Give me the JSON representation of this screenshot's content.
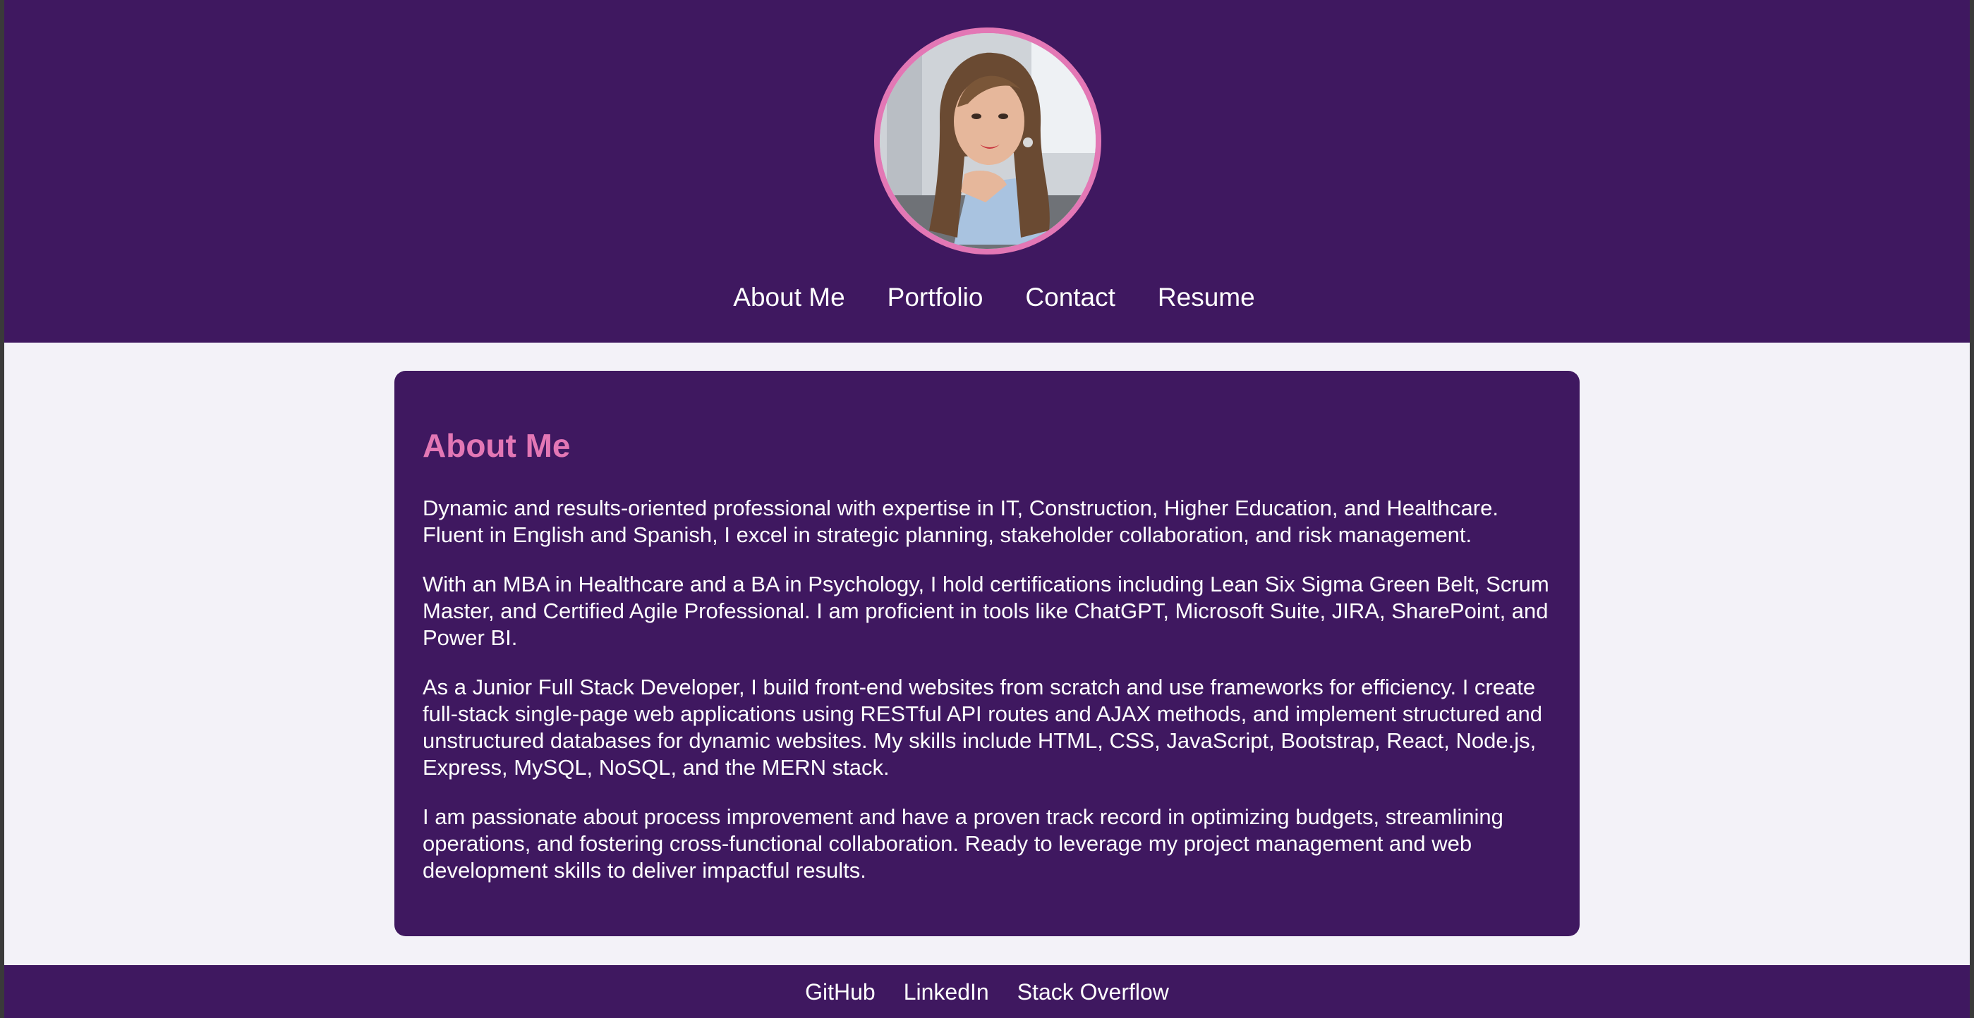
{
  "header": {
    "avatar_alt": "Profile photo",
    "nav": [
      {
        "label": "About Me"
      },
      {
        "label": "Portfolio"
      },
      {
        "label": "Contact"
      },
      {
        "label": "Resume"
      }
    ]
  },
  "main": {
    "heading": "About Me",
    "paragraphs": [
      "Dynamic and results-oriented professional with expertise in IT, Construction, Higher Education, and Healthcare. Fluent in English and Spanish, I excel in strategic planning, stakeholder collaboration, and risk management.",
      "With an MBA in Healthcare and a BA in Psychology, I hold certifications including Lean Six Sigma Green Belt, Scrum Master, and Certified Agile Professional. I am proficient in tools like ChatGPT, Microsoft Suite, JIRA, SharePoint, and Power BI.",
      "As a Junior Full Stack Developer, I build front-end websites from scratch and use frameworks for efficiency. I create full-stack single-page web applications using RESTful API routes and AJAX methods, and implement structured and unstructured databases for dynamic websites. My skills include HTML, CSS, JavaScript, Bootstrap, React, Node.js, Express, MySQL, NoSQL, and the MERN stack.",
      "I am passionate about process improvement and have a proven track record in optimizing budgets, streamlining operations, and fostering cross-functional collaboration. Ready to leverage my project management and web development skills to deliver impactful results."
    ]
  },
  "footer": {
    "links": [
      {
        "label": "GitHub"
      },
      {
        "label": "LinkedIn"
      },
      {
        "label": "Stack Overflow"
      }
    ]
  },
  "colors": {
    "primary": "#3f1860",
    "accent": "#e377b5",
    "background": "#f3f2f8",
    "text": "#ffffff"
  }
}
